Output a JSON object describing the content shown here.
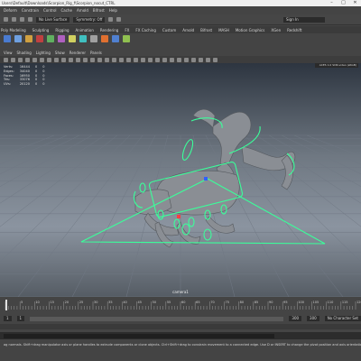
{
  "window": {
    "title": "Users\\Default\\Downloads\\Scorpion_Rig_f\\Scorpion_nocut_CTRL",
    "controls": [
      "–",
      "□",
      "✕"
    ]
  },
  "menubar": {
    "items": [
      "Deform",
      "Constrain",
      "Control",
      "Cache",
      "Arnold",
      "Bifrost",
      "Help"
    ]
  },
  "statusline": {
    "surface_field": "No Live Surface",
    "symmetry": "Symmetry: Off",
    "sign_in": "Sign In"
  },
  "shelf": {
    "tabs": [
      "Poly Modeling",
      "Sculpting",
      "Rigging",
      "Animation",
      "Rendering",
      "FX",
      "FX Caching",
      "Custom",
      "Arnold",
      "Bifrost",
      "MASH",
      "Motion Graphics",
      "XGen",
      "Redshift"
    ],
    "icon_colors": [
      "#4a7bd0",
      "#6fa0e0",
      "#d0a040",
      "#c04040",
      "#60b060",
      "#b060c0",
      "#d0d060",
      "#40c0c0",
      "#a0a0a0",
      "#e07030",
      "#5080d0",
      "#90c050"
    ]
  },
  "panel": {
    "menu": [
      "View",
      "Shading",
      "Lighting",
      "Show",
      "Renderer",
      "Panels"
    ],
    "color_space": "ACES 1.0 SDR-video (sRGB)",
    "hud": [
      {
        "label": "Verts:",
        "a": "16444",
        "b": "0",
        "c": "0"
      },
      {
        "label": "Edges:",
        "a": "34040",
        "b": "0",
        "c": "0"
      },
      {
        "label": "Faces:",
        "a": "16950",
        "b": "0",
        "c": "0"
      },
      {
        "label": "Tris:",
        "a": "33076",
        "b": "0",
        "c": "0"
      },
      {
        "label": "UVs:",
        "a": "20120",
        "b": "0",
        "c": "0"
      }
    ],
    "camera": "camera1"
  },
  "timeline": {
    "ticks": [
      "5",
      "10",
      "15",
      "20",
      "25",
      "30",
      "35",
      "40",
      "45",
      "50",
      "55",
      "60",
      "65",
      "70",
      "75",
      "80",
      "85",
      "90",
      "95",
      "100",
      "105",
      "110",
      "115",
      "120"
    ],
    "current_frame": "1"
  },
  "range": {
    "start": "1",
    "range_start": "1",
    "range_end": "300",
    "end": "300",
    "character_set": "No Character Set"
  },
  "help": {
    "text": "ag normals. Shift+drag manipulator axis or plane handles to extrude components or clone objects. Ctrl+Shift+drag to constrain movement to a connected edge. Use D or INSERT to change the pivot position and axis orientation."
  },
  "colors": {
    "control_curve": "#3aff9a",
    "mesh": "#8a8e94",
    "grid": "#6f7680"
  }
}
